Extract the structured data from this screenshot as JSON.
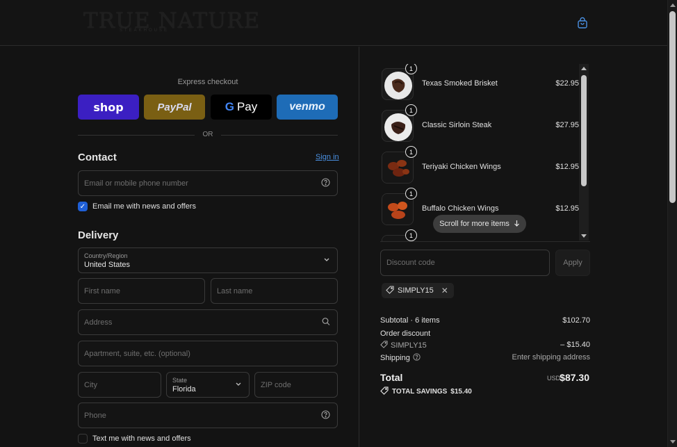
{
  "brand": {
    "logo_text": "TRUE NATURE",
    "logo_subtext": "STEAKHOUSE"
  },
  "colors": {
    "accent": "#4a90e2",
    "checkbox": "#1f5fd6",
    "shop": "#3b1fc2",
    "paypal": "#7a5f13",
    "gpay": "#000000",
    "venmo": "#1e6cb7"
  },
  "express": {
    "label": "Express checkout",
    "shop": "shop",
    "paypal": "PayPal",
    "gpay_g": "G",
    "gpay": "Pay",
    "venmo": "venmo",
    "or": "OR"
  },
  "contact": {
    "title": "Contact",
    "sign_in": "Sign in",
    "email_placeholder": "Email or mobile phone number",
    "newsletter_label": "Email me with news and offers",
    "newsletter_checked": true
  },
  "delivery": {
    "title": "Delivery",
    "country_label": "Country/Region",
    "country_value": "United States",
    "first_name": "First name",
    "last_name": "Last name",
    "address": "Address",
    "apartment": "Apartment, suite, etc. (optional)",
    "city": "City",
    "state_label": "State",
    "state_value": "Florida",
    "zip": "ZIP code",
    "phone": "Phone",
    "sms_label": "Text me with news and offers",
    "sms_checked": false
  },
  "cart": {
    "items": [
      {
        "name": "Texas Smoked Brisket",
        "price": "$22.95",
        "qty": "1",
        "image": "brisket-photo"
      },
      {
        "name": "Classic Sirloin Steak",
        "price": "$27.95",
        "qty": "1",
        "image": "steak-photo"
      },
      {
        "name": "Teriyaki Chicken Wings",
        "price": "$12.95",
        "qty": "1",
        "image": "wings-photo"
      },
      {
        "name": "Buffalo Chicken Wings",
        "price": "$12.95",
        "qty": "1",
        "image": "wings-photo"
      },
      {
        "name": "",
        "price": "",
        "qty": "1",
        "image": "food-photo"
      }
    ],
    "scroll_hint": "Scroll for more items",
    "discount_placeholder": "Discount code",
    "apply": "Apply",
    "applied_code": "SIMPLY15"
  },
  "summary": {
    "subtotal_label": "Subtotal · 6 items",
    "subtotal_value": "$102.70",
    "order_discount_label": "Order discount",
    "discount_code": "SIMPLY15",
    "discount_value": "– $15.40",
    "shipping_label": "Shipping",
    "shipping_value": "Enter shipping address",
    "total_label": "Total",
    "currency": "USD",
    "total_value": "$87.30",
    "savings_label": "TOTAL SAVINGS",
    "savings_value": "$15.40"
  }
}
